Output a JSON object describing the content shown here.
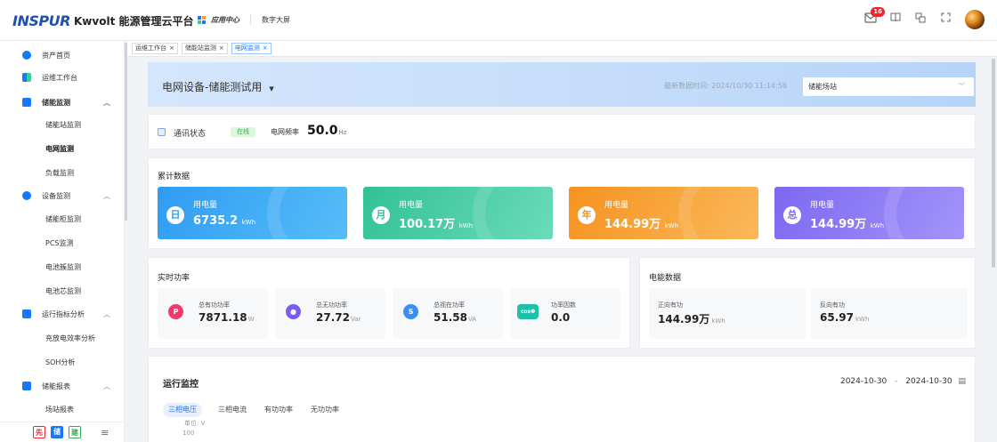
{
  "topbar": {
    "logo": "INSPUR",
    "app_title": "Kwvolt 能源管理云平台",
    "nav_app_center": "应用中心",
    "nav_digital_screen": "数字大屏",
    "notification_count": "16"
  },
  "sidebar": {
    "items": [
      {
        "label": "资产首页"
      },
      {
        "label": "运维工作台"
      },
      {
        "label": "储能监测"
      },
      {
        "label": "储能站监测"
      },
      {
        "label": "电网监测"
      },
      {
        "label": "负载监测"
      },
      {
        "label": "设备监测"
      },
      {
        "label": "储能柜监测"
      },
      {
        "label": "PCS监测"
      },
      {
        "label": "电池簇监测"
      },
      {
        "label": "电池芯监测"
      },
      {
        "label": "运行指标分析"
      },
      {
        "label": "充放电效率分析"
      },
      {
        "label": "SOH分析"
      },
      {
        "label": "储能报表"
      },
      {
        "label": "场站报表"
      }
    ],
    "bottom": {
      "b1": "先",
      "b2": "储",
      "b3": "建",
      "menu": "≡"
    }
  },
  "tabs": [
    {
      "label": "运维工作台"
    },
    {
      "label": "储能站监测"
    },
    {
      "label": "电网监测"
    }
  ],
  "header": {
    "title": "电网设备-储能测试用",
    "update_time": "最新数据时间: 2024/10/30 11:14:58",
    "station_select": "储能场站"
  },
  "comm": {
    "label": "通讯状态",
    "status": "在线",
    "freq_label": "电网频率",
    "freq_value": "50.0",
    "freq_unit": "Hz"
  },
  "cumulative": {
    "title": "累计数据",
    "cards": [
      {
        "badge": "日",
        "label": "用电量",
        "value": "6735.2",
        "unit": "kWh",
        "color": "#36a9f5"
      },
      {
        "badge": "月",
        "label": "用电量",
        "value": "100.17万",
        "unit": "kWh",
        "color": "#3ecb9c"
      },
      {
        "badge": "年",
        "label": "用电量",
        "value": "144.99万",
        "unit": "kWh",
        "color": "#f7a12e"
      },
      {
        "badge": "总",
        "label": "用电量",
        "value": "144.99万",
        "unit": "kWh",
        "color": "#8b7af5"
      }
    ]
  },
  "realtime": {
    "title": "实时功率",
    "metrics": [
      {
        "icon": "P",
        "label": "总有功功率",
        "value": "7871.18",
        "unit": "W",
        "color": "#f03a6b"
      },
      {
        "icon": "Q",
        "label": "总无功功率",
        "value": "27.72",
        "unit": "Var",
        "color": "#7b5cf0"
      },
      {
        "icon": "S",
        "label": "总视在功率",
        "value": "51.58",
        "unit": "VA",
        "color": "#3a8ef5"
      },
      {
        "icon": "cosΦ",
        "label": "功率因数",
        "value": "0.0",
        "unit": "",
        "color": "#1fc0a8"
      }
    ]
  },
  "energy": {
    "title": "电能数据",
    "metrics": [
      {
        "label": "正向有功",
        "value": "144.99万",
        "unit": "kWh"
      },
      {
        "label": "反向有功",
        "value": "65.97",
        "unit": "kWh"
      }
    ]
  },
  "operation": {
    "title": "运行监控",
    "date_start": "2024-10-30",
    "date_sep": "-",
    "date_end": "2024-10-30",
    "subtabs": [
      "三相电压",
      "三相电流",
      "有功功率",
      "无功功率"
    ],
    "unit_label": "单位: V",
    "y_tick": "100"
  }
}
